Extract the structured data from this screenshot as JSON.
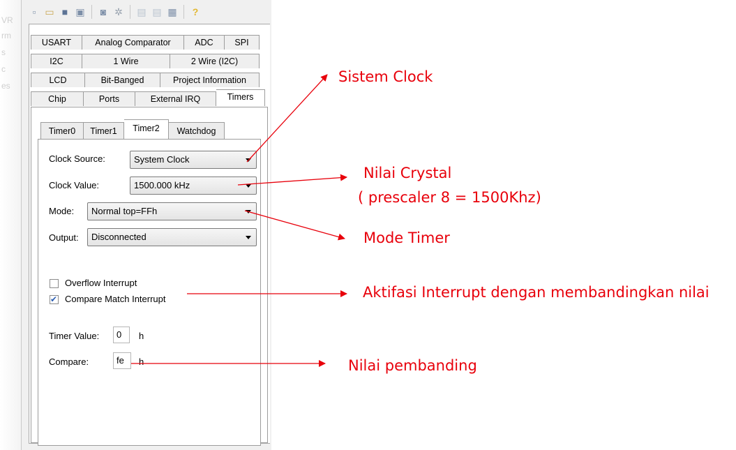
{
  "left_ghost_text": [
    "VR",
    "rm",
    "s",
    "c",
    "es"
  ],
  "toolbar": {
    "icons": [
      "new-icon",
      "open-icon",
      "save-icon",
      "save-all-icon",
      "preview-icon",
      "generate-icon",
      "copy-icon",
      "paste-icon",
      "document-icon",
      "help-icon"
    ],
    "glyphs": [
      "▫",
      "▭",
      "■",
      "▣",
      "◙",
      "✲",
      "▤",
      "▤",
      "▦",
      "?"
    ]
  },
  "tabs": {
    "row1": [
      "USART",
      "Analog Comparator",
      "ADC",
      "SPI"
    ],
    "row2": [
      "I2C",
      "1 Wire",
      "2 Wire (I2C)"
    ],
    "row3": [
      "LCD",
      "Bit-Banged",
      "Project Information"
    ],
    "row4": [
      "Chip",
      "Ports",
      "External IRQ",
      "Timers"
    ]
  },
  "subtabs": [
    "Timer0",
    "Timer1",
    "Timer2",
    "Watchdog"
  ],
  "form": {
    "clock_source_label": "Clock Source:",
    "clock_source_value": "System Clock",
    "clock_value_label": "Clock Value:",
    "clock_value_value": "1500.000 kHz",
    "mode_label": "Mode:",
    "mode_value": "Normal top=FFh",
    "output_label": "Output:",
    "output_value": "Disconnected",
    "overflow_label": "Overflow Interrupt",
    "overflow_checked": false,
    "compare_match_label": "Compare Match Interrupt",
    "compare_match_checked": true,
    "timer_value_label": "Timer Value:",
    "timer_value": "0",
    "timer_value_unit": "h",
    "compare_label": "Compare:",
    "compare_value": "fe",
    "compare_unit": "h"
  },
  "annotations": {
    "sistem_clock": "Sistem Clock",
    "nilai_crystal_1": "Nilai Crystal",
    "nilai_crystal_2": "( prescaler 8 = 1500Khz)",
    "mode_timer": "Mode Timer",
    "aktifasi": "Aktifasi Interrupt dengan membandingkan nilai",
    "nilai_pembanding": "Nilai pembanding"
  },
  "colors": {
    "annotation": "#e8000b",
    "check": "#2c5fb3"
  }
}
